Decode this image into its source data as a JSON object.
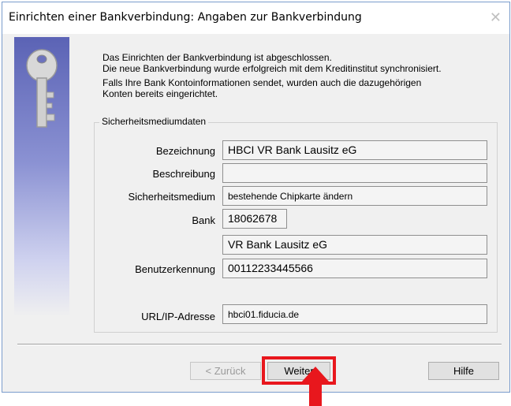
{
  "dialog": {
    "title": "Einrichten einer Bankverbindung: Angaben zur Bankverbindung",
    "intro_line1": "Das Einrichten der Bankverbindung ist abgeschlossen.",
    "intro_line2": "Die neue Bankverbindung wurde erfolgreich mit dem Kreditinstitut synchronisiert.",
    "intro_line3": "Falls Ihre Bank Kontoinformationen sendet, wurden auch die dazugehörigen",
    "intro_line4": "Konten bereits eingerichtet."
  },
  "security": {
    "group_label": "Sicherheitsmediumdaten",
    "bezeichnung_label": "Bezeichnung",
    "bezeichnung_value": "HBCI VR Bank Lausitz eG",
    "beschreibung_label": "Beschreibung",
    "beschreibung_value": "",
    "medium_label": "Sicherheitsmedium",
    "medium_value": "bestehende Chipkarte ändern",
    "bank_label": "Bank",
    "bank_code": "18062678",
    "bank_name": "VR Bank Lausitz eG",
    "user_label": "Benutzerkennung",
    "user_value": "00112233445566",
    "url_label": "URL/IP-Adresse",
    "url_value": "hbci01.fiducia.de"
  },
  "buttons": {
    "back": "< Zurück",
    "next": "Weiter",
    "help": "Hilfe"
  },
  "icons": {
    "close": "close-icon",
    "key": "key-icon",
    "arrow": "arrow-up-icon"
  },
  "colors": {
    "highlight": "#e8171d",
    "sidebar_top": "#5b63b5"
  }
}
